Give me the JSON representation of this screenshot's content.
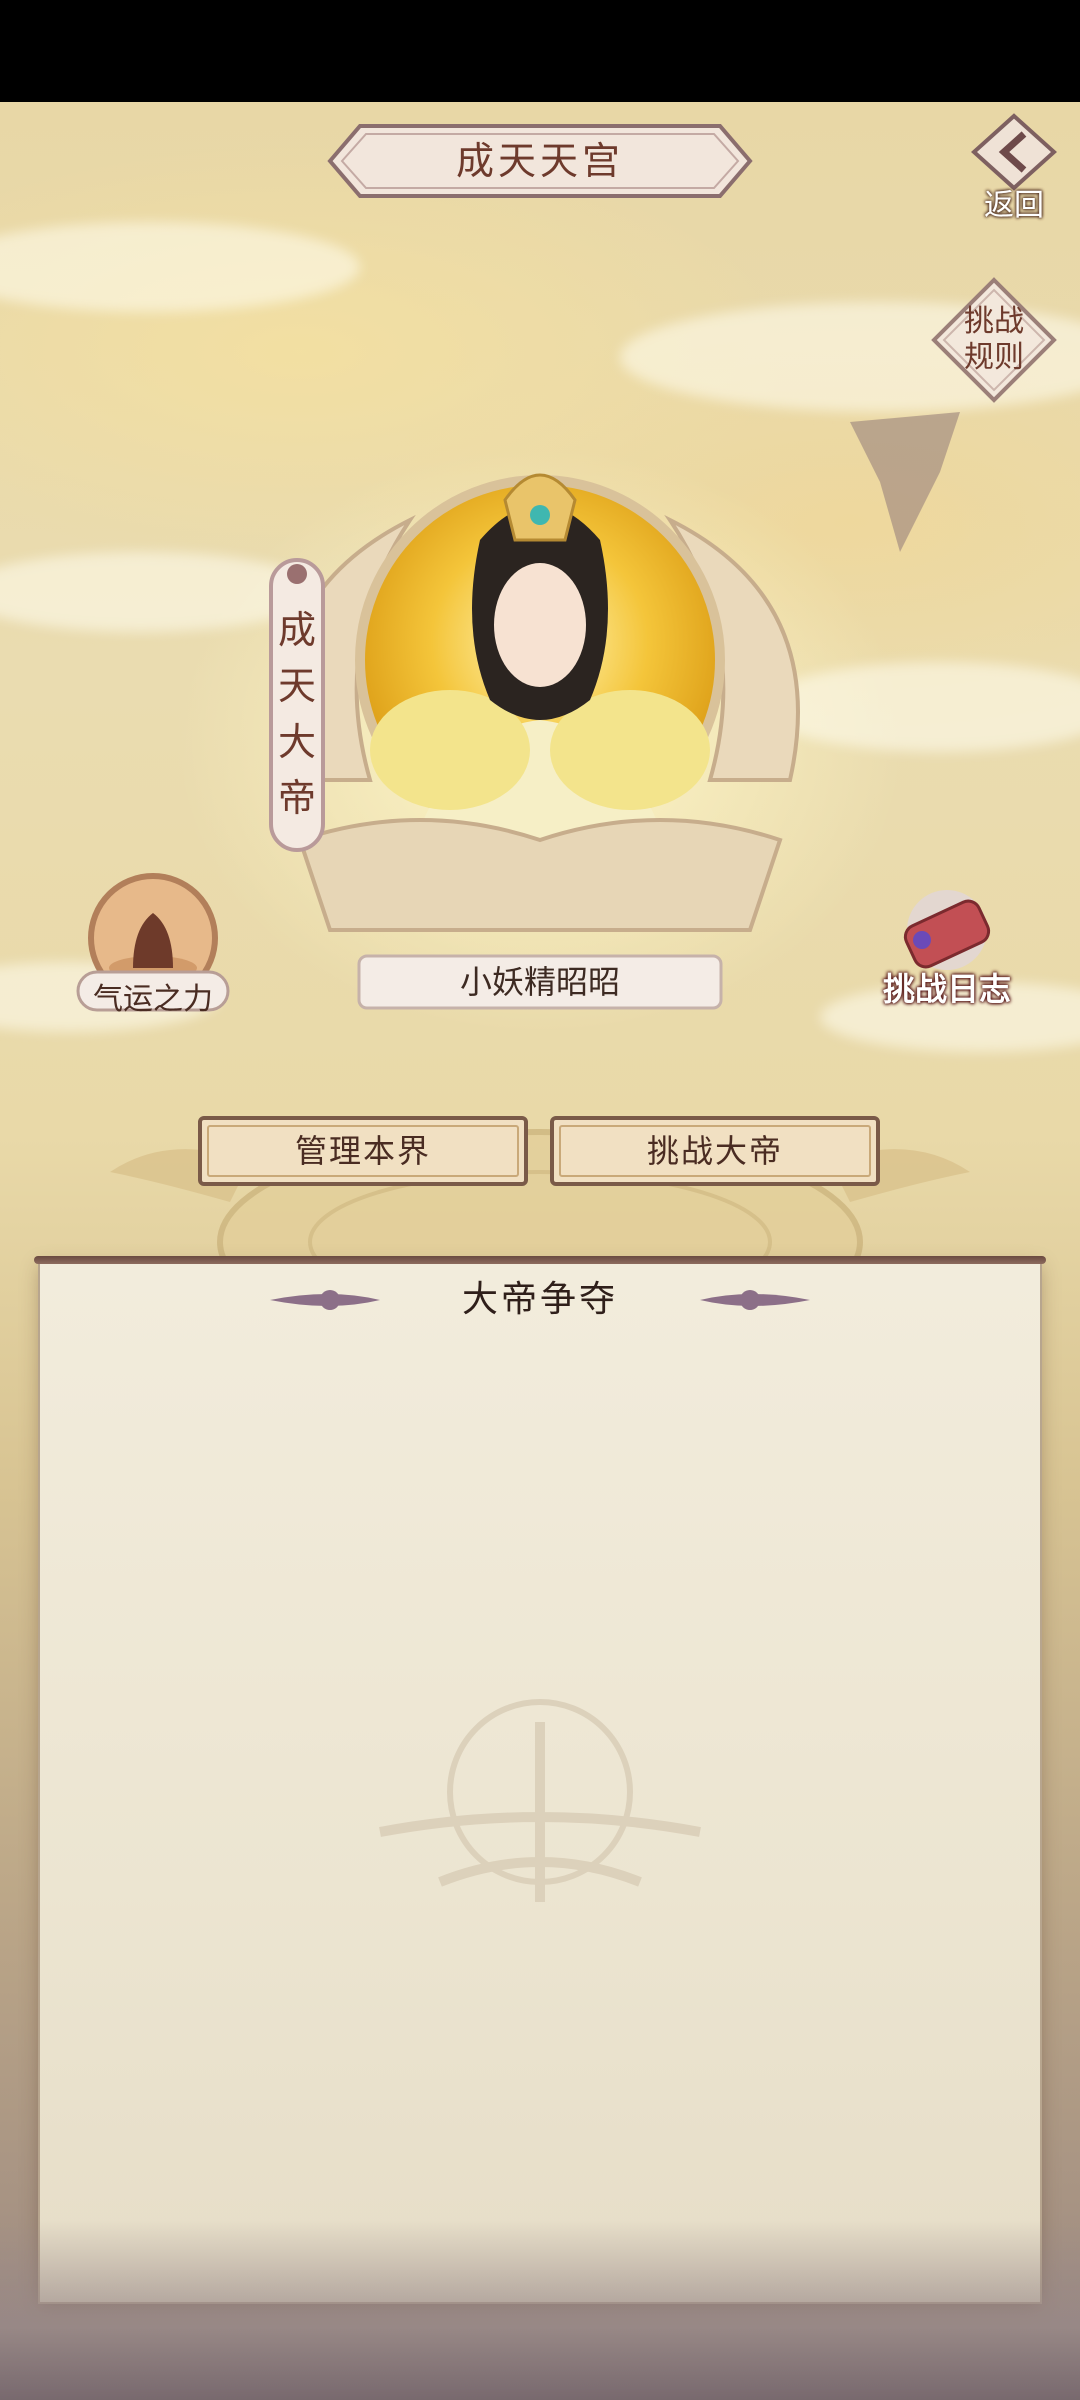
{
  "header": {
    "title": "成天天宫",
    "back_label": "返回",
    "rules_label_line1": "挑战",
    "rules_label_line2": "规则"
  },
  "emperor": {
    "rank_char1": "成",
    "rank_char2": "天",
    "rank_char3": "大",
    "rank_char4": "帝",
    "player_name": "小妖精昭昭"
  },
  "side_buttons": {
    "fortune": "气运之力",
    "challenge_log": "挑战日志"
  },
  "actions": {
    "manage": "管理本界",
    "challenge": "挑战大帝"
  },
  "panel": {
    "title": "大帝争夺"
  },
  "colors": {
    "text_brown": "#6e3a2c",
    "plaque_fill": "#f1e4d8",
    "accent_red": "#8a2b2b"
  }
}
